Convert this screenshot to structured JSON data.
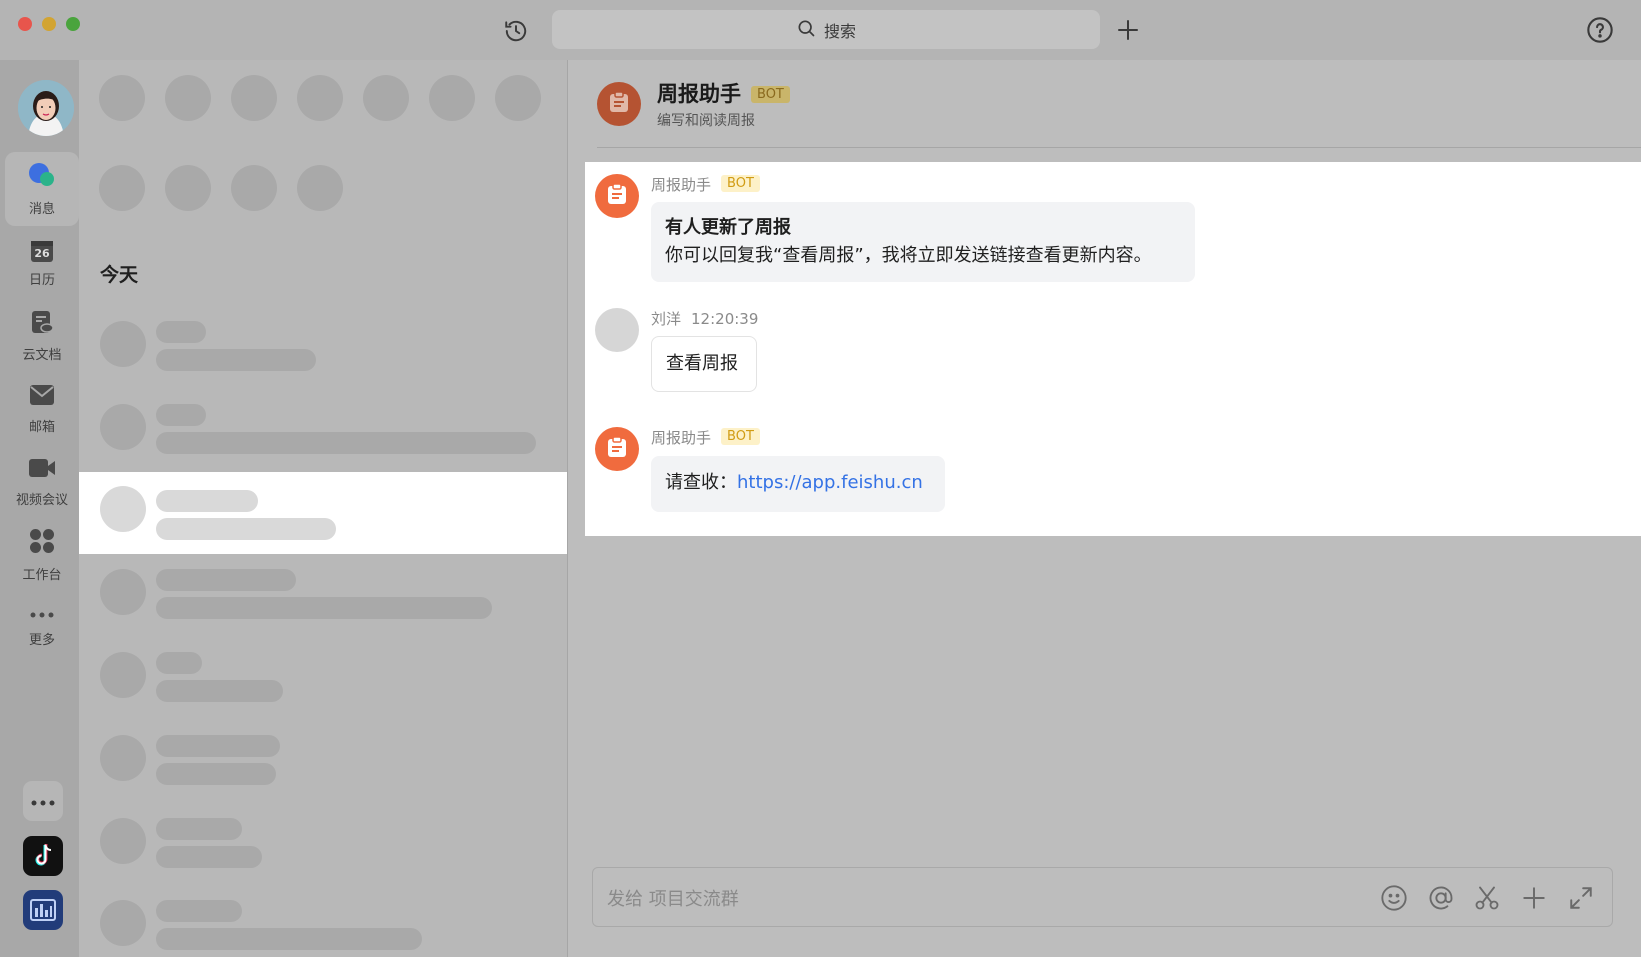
{
  "titlebar": {
    "search_placeholder": "搜索"
  },
  "nav": {
    "items": [
      {
        "label": "消息",
        "icon": "chat-bubbles-icon"
      },
      {
        "label": "日历",
        "icon": "calendar-icon",
        "badge": "26"
      },
      {
        "label": "云文档",
        "icon": "cloud-doc-icon"
      },
      {
        "label": "邮箱",
        "icon": "mail-icon"
      },
      {
        "label": "视频会议",
        "icon": "video-camera-icon"
      },
      {
        "label": "工作台",
        "icon": "apps-grid-icon"
      },
      {
        "label": "更多",
        "icon": "more-dots-icon"
      }
    ]
  },
  "list": {
    "section_label": "今天"
  },
  "chat": {
    "title": "周报助手",
    "bot_badge": "BOT",
    "subtitle": "编写和阅读周报",
    "messages": [
      {
        "sender": "周报助手",
        "badge": "BOT",
        "heading": "有人更新了周报",
        "body": "你可以回复我“查看周报”，我将立即发送链接查看更新内容。"
      },
      {
        "sender": "刘洋",
        "time": "12:20:39",
        "body": "查看周报"
      },
      {
        "sender": "周报助手",
        "badge": "BOT",
        "prefix": "请查收：",
        "link": "https://app.feishu.cn"
      }
    ],
    "input_placeholder": "发给 项目交流群"
  },
  "colors": {
    "accent_orange": "#f06b3e",
    "link_blue": "#3472e5",
    "bot_badge_text": "#d19c14"
  }
}
